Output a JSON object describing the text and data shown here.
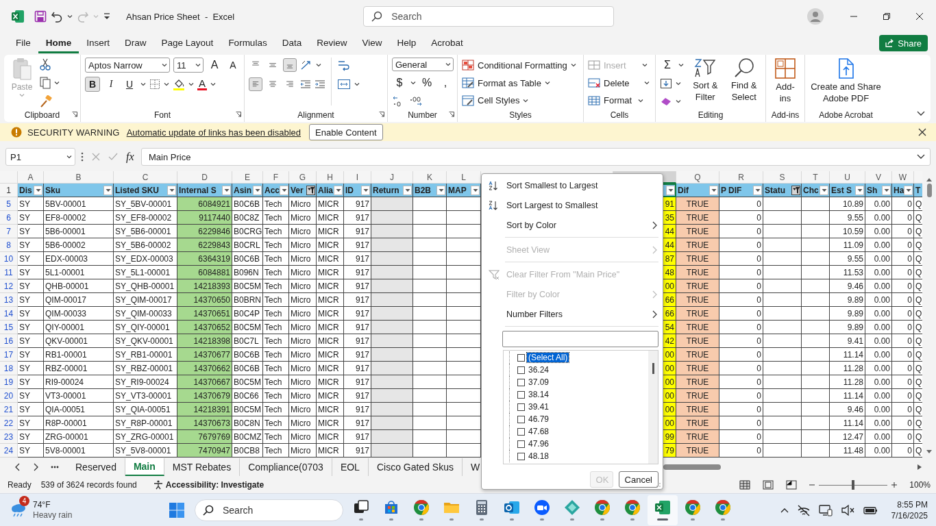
{
  "window": {
    "title": "Ahsan Price Sheet  -  Excel",
    "search_placeholder": "Search"
  },
  "ribbon_tabs": [
    {
      "label": "File",
      "selected": false
    },
    {
      "label": "Home",
      "selected": true
    },
    {
      "label": "Insert",
      "selected": false
    },
    {
      "label": "Draw",
      "selected": false
    },
    {
      "label": "Page Layout",
      "selected": false
    },
    {
      "label": "Formulas",
      "selected": false
    },
    {
      "label": "Data",
      "selected": false
    },
    {
      "label": "Review",
      "selected": false
    },
    {
      "label": "View",
      "selected": false
    },
    {
      "label": "Help",
      "selected": false
    },
    {
      "label": "Acrobat",
      "selected": false
    }
  ],
  "share_button": "Share",
  "ribbon": {
    "paste": "Paste",
    "font_name": "Aptos Narrow",
    "font_size": "11",
    "size_buttons": [
      "A",
      "A"
    ],
    "format_toggles": [
      {
        "kind": "bold",
        "label": "B",
        "on": true
      },
      {
        "kind": "italic",
        "label": "I",
        "on": false
      },
      {
        "kind": "underline",
        "label": "U",
        "on": false
      }
    ],
    "font_color_label": "A",
    "vertical_align": [
      {
        "kind": "top",
        "on": false
      },
      {
        "kind": "middle",
        "on": false
      },
      {
        "kind": "bottom",
        "on": true
      }
    ],
    "horizontal_align": [
      {
        "kind": "left",
        "on": true
      },
      {
        "kind": "center",
        "on": false
      },
      {
        "kind": "right",
        "on": false
      }
    ],
    "number_format": "General",
    "number_buttons": [
      "$",
      "%",
      ","
    ],
    "styles": [
      "Conditional Formatting",
      "Format as Table",
      "Cell Styles"
    ],
    "cells": [
      {
        "label": "Insert",
        "disabled": true
      },
      {
        "label": "Delete",
        "disabled": false
      },
      {
        "label": "Format",
        "disabled": false
      }
    ],
    "sum_label": "Σ",
    "editing": [
      "Sort & Filter",
      "Find & Select"
    ],
    "addins": "Add-ins",
    "acrobat": "Create and Share Adobe PDF",
    "group_labels": [
      "Clipboard",
      "Font",
      "Alignment",
      "Number",
      "Styles",
      "Cells",
      "Editing",
      "Add-ins",
      "Adobe Acrobat"
    ]
  },
  "security_bar": {
    "title": "SECURITY WARNING",
    "message": "Automatic update of links has been disabled",
    "button": "Enable Content"
  },
  "formula_bar": {
    "name_box": "P1",
    "function_label": "fx",
    "formula": "Main Price"
  },
  "columns": [
    {
      "letter": "A",
      "header": "Dis",
      "kind": "text",
      "filtered": false,
      "selected": false
    },
    {
      "letter": "B",
      "header": "Sku",
      "kind": "text",
      "filtered": false,
      "selected": false
    },
    {
      "letter": "C",
      "header": "Listed SKU",
      "kind": "text",
      "filtered": false,
      "selected": false
    },
    {
      "letter": "D",
      "header": "Internal S",
      "kind": "number",
      "color": "#a6d98f",
      "filtered": false,
      "selected": false
    },
    {
      "letter": "E",
      "header": "Asin",
      "kind": "text",
      "filtered": false,
      "selected": false
    },
    {
      "letter": "F",
      "header": "Acc",
      "kind": "text",
      "filtered": false,
      "selected": false
    },
    {
      "letter": "G",
      "header": "Ver",
      "kind": "text",
      "filtered": true,
      "selected": false
    },
    {
      "letter": "H",
      "header": "Alia",
      "kind": "text",
      "filtered": false,
      "selected": false
    },
    {
      "letter": "I",
      "header": "ID",
      "kind": "number",
      "filtered": false,
      "selected": false
    },
    {
      "letter": "J",
      "header": "Return",
      "kind": "text",
      "color": "#e6e6e6",
      "filtered": false,
      "selected": false
    },
    {
      "letter": "K",
      "header": "B2B",
      "kind": "text",
      "filtered": false,
      "selected": false
    },
    {
      "letter": "L",
      "header": "MAP",
      "kind": "text",
      "filtered": false,
      "selected": false
    },
    {
      "kind": "number",
      "color": "#ffff00",
      "filtered": false,
      "selected": true
    },
    {
      "letter": "Q",
      "header": "Dif",
      "kind": "bool",
      "color": "#f8cbad",
      "filtered": false,
      "selected": false
    },
    {
      "letter": "R",
      "header": "P DIF",
      "kind": "number",
      "filtered": false,
      "selected": false
    },
    {
      "letter": "S",
      "header": "Statu",
      "kind": "text",
      "filtered": true,
      "selected": false
    },
    {
      "letter": "T",
      "header": "Chc",
      "kind": "text",
      "filtered": false,
      "selected": false
    },
    {
      "letter": "U",
      "header": "Est S",
      "kind": "number",
      "filtered": false,
      "selected": false
    },
    {
      "letter": "V",
      "header": "Sh",
      "kind": "number",
      "filtered": false,
      "selected": false
    },
    {
      "letter": "W",
      "header": "Ha",
      "kind": "number",
      "filtered": false,
      "selected": false
    },
    {
      "header": "T",
      "kind": "text",
      "selected": false
    }
  ],
  "header_row": "1",
  "rows": [
    {
      "number": "5",
      "cells": [
        "SY",
        "5BV-00001",
        "SY_5BV-00001",
        "6084921",
        "B0C6B",
        "Tech",
        "Micro",
        "MICR",
        "917",
        null,
        null,
        null,
        "91",
        "TRUE",
        "0",
        null,
        null,
        "10.89",
        "0.00",
        "0",
        "Q"
      ]
    },
    {
      "number": "6",
      "cells": [
        "SY",
        "EF8-00002",
        "SY_EF8-00002",
        "9117440",
        "B0C8Z",
        "Tech",
        "Micro",
        "MICR",
        "917",
        null,
        null,
        null,
        "35",
        "TRUE",
        "0",
        null,
        null,
        "9.55",
        "0.00",
        "0",
        "Q"
      ]
    },
    {
      "number": "7",
      "cells": [
        "SY",
        "5B6-00001",
        "SY_5B6-00001",
        "6229846",
        "B0CRG",
        "Tech",
        "Micro",
        "MICR",
        "917",
        null,
        null,
        null,
        "44",
        "TRUE",
        "0",
        null,
        null,
        "10.59",
        "0.00",
        "0",
        "Q"
      ]
    },
    {
      "number": "8",
      "cells": [
        "SY",
        "5B6-00002",
        "SY_5B6-00002",
        "6229843",
        "B0CRL",
        "Tech",
        "Micro",
        "MICR",
        "917",
        null,
        null,
        null,
        "44",
        "TRUE",
        "0",
        null,
        null,
        "11.09",
        "0.00",
        "0",
        "Q"
      ]
    },
    {
      "number": "10",
      "cells": [
        "SY",
        "EDX-00003",
        "SY_EDX-00003",
        "6364319",
        "B0C6B",
        "Tech",
        "Micro",
        "MICR",
        "917",
        null,
        null,
        null,
        "87",
        "TRUE",
        "0",
        null,
        null,
        "9.55",
        "0.00",
        "0",
        "Q"
      ]
    },
    {
      "number": "11",
      "cells": [
        "SY",
        "5L1-00001",
        "SY_5L1-00001",
        "6084881",
        "B096N",
        "Tech",
        "Micro",
        "MICR",
        "917",
        null,
        null,
        null,
        "48",
        "TRUE",
        "0",
        null,
        null,
        "11.53",
        "0.00",
        "0",
        "Q"
      ]
    },
    {
      "number": "12",
      "cells": [
        "SY",
        "QHB-00001",
        "SY_QHB-00001",
        "14218393",
        "B0C5M",
        "Tech",
        "Micro",
        "MICR",
        "917",
        null,
        null,
        null,
        "00",
        "TRUE",
        "0",
        null,
        null,
        "9.46",
        "0.00",
        "0",
        "Q"
      ]
    },
    {
      "number": "13",
      "cells": [
        "SY",
        "QIM-00017",
        "SY_QIM-00017",
        "14370650",
        "B0BRN",
        "Tech",
        "Micro",
        "MICR",
        "917",
        null,
        null,
        null,
        "66",
        "TRUE",
        "0",
        null,
        null,
        "9.89",
        "0.00",
        "0",
        "Q"
      ]
    },
    {
      "number": "14",
      "cells": [
        "SY",
        "QIM-00033",
        "SY_QIM-00033",
        "14370651",
        "B0C4P",
        "Tech",
        "Micro",
        "MICR",
        "917",
        null,
        null,
        null,
        "66",
        "TRUE",
        "0",
        null,
        null,
        "9.89",
        "0.00",
        "0",
        "Q"
      ]
    },
    {
      "number": "15",
      "cells": [
        "SY",
        "QIY-00001",
        "SY_QIY-00001",
        "14370652",
        "B0C5M",
        "Tech",
        "Micro",
        "MICR",
        "917",
        null,
        null,
        null,
        "54",
        "TRUE",
        "0",
        null,
        null,
        "9.89",
        "0.00",
        "0",
        "Q"
      ]
    },
    {
      "number": "16",
      "cells": [
        "SY",
        "QKV-00001",
        "SY_QKV-00001",
        "14218398",
        "B0C7L",
        "Tech",
        "Micro",
        "MICR",
        "917",
        null,
        null,
        null,
        "42",
        "TRUE",
        "0",
        null,
        null,
        "9.41",
        "0.00",
        "0",
        "Q"
      ]
    },
    {
      "number": "17",
      "cells": [
        "SY",
        "RB1-00001",
        "SY_RB1-00001",
        "14370677",
        "B0C6B",
        "Tech",
        "Micro",
        "MICR",
        "917",
        null,
        null,
        null,
        "00",
        "TRUE",
        "0",
        null,
        null,
        "11.14",
        "0.00",
        "0",
        "Q"
      ]
    },
    {
      "number": "18",
      "cells": [
        "SY",
        "RBZ-00001",
        "SY_RBZ-00001",
        "14370662",
        "B0C6B",
        "Tech",
        "Micro",
        "MICR",
        "917",
        null,
        null,
        null,
        "00",
        "TRUE",
        "0",
        null,
        null,
        "11.28",
        "0.00",
        "0",
        "Q"
      ]
    },
    {
      "number": "19",
      "cells": [
        "SY",
        "RI9-00024",
        "SY_RI9-00024",
        "14370667",
        "B0C5M",
        "Tech",
        "Micro",
        "MICR",
        "917",
        null,
        null,
        null,
        "00",
        "TRUE",
        "0",
        null,
        null,
        "11.28",
        "0.00",
        "0",
        "Q"
      ]
    },
    {
      "number": "20",
      "cells": [
        "SY",
        "VT3-00001",
        "SY_VT3-00001",
        "14370679",
        "B0C66",
        "Tech",
        "Micro",
        "MICR",
        "917",
        null,
        null,
        null,
        "00",
        "TRUE",
        "0",
        null,
        null,
        "11.14",
        "0.00",
        "0",
        "Q"
      ]
    },
    {
      "number": "21",
      "cells": [
        "SY",
        "QIA-00051",
        "SY_QIA-00051",
        "14218391",
        "B0C5M",
        "Tech",
        "Micro",
        "MICR",
        "917",
        null,
        null,
        null,
        "00",
        "TRUE",
        "0",
        null,
        null,
        "9.46",
        "0.00",
        "0",
        "Q"
      ]
    },
    {
      "number": "22",
      "cells": [
        "SY",
        "R8P-00001",
        "SY_R8P-00001",
        "14370673",
        "B0C8N",
        "Tech",
        "Micro",
        "MICR",
        "917",
        null,
        null,
        null,
        "00",
        "TRUE",
        "0",
        null,
        null,
        "11.14",
        "0.00",
        "0",
        "Q"
      ]
    },
    {
      "number": "23",
      "cells": [
        "SY",
        "ZRG-00001",
        "SY_ZRG-00001",
        "7679769",
        "B0CMZ",
        "Tech",
        "Micro",
        "MICR",
        "917",
        null,
        null,
        null,
        "99",
        "TRUE",
        "0",
        null,
        null,
        "12.47",
        "0.00",
        "0",
        "Q"
      ]
    },
    {
      "number": "24",
      "cells": [
        "SY",
        "5V8-00001",
        "SY_5V8-00001",
        "7470947",
        "B0CB8",
        "Tech",
        "Micro",
        "MICR",
        "917",
        null,
        null,
        null,
        "79",
        "TRUE",
        "0",
        null,
        null,
        "11.48",
        "0.00",
        "0",
        "Q"
      ]
    }
  ],
  "filter_menu": {
    "sections": [
      [
        {
          "label": "Sort Smallest to Largest",
          "kind": "sort-asc",
          "submenu": false,
          "disabled": false
        },
        {
          "label": "Sort Largest to Smallest",
          "kind": "sort-desc",
          "submenu": false,
          "disabled": false
        },
        {
          "label": "Sort by Color",
          "kind": "plain",
          "submenu": true,
          "disabled": false
        }
      ],
      [
        {
          "label": "Sheet View",
          "kind": "plain",
          "submenu": true,
          "disabled": true
        }
      ],
      [
        {
          "label": "Clear Filter From \"Main Price\"",
          "kind": "clear-filter",
          "submenu": false,
          "disabled": true
        },
        {
          "label": "Filter by Color",
          "kind": "plain",
          "submenu": true,
          "disabled": true
        },
        {
          "label": "Number Filters",
          "kind": "plain",
          "submenu": true,
          "disabled": false
        }
      ]
    ],
    "values": [
      {
        "label": "(Select All)",
        "checked": false,
        "selected": true
      },
      {
        "label": "36.24",
        "checked": false,
        "selected": false
      },
      {
        "label": "37.09",
        "checked": false,
        "selected": false
      },
      {
        "label": "38.14",
        "checked": false,
        "selected": false
      },
      {
        "label": "39.41",
        "checked": false,
        "selected": false
      },
      {
        "label": "46.79",
        "checked": false,
        "selected": false
      },
      {
        "label": "47.68",
        "checked": false,
        "selected": false
      },
      {
        "label": "47.96",
        "checked": false,
        "selected": false
      },
      {
        "label": "48.18",
        "checked": false,
        "selected": false
      }
    ],
    "buttons": [
      {
        "label": "OK",
        "disabled": true
      },
      {
        "label": "Cancel",
        "disabled": false
      }
    ]
  },
  "sheet_tabs": [
    {
      "label": "Reserved",
      "selected": false
    },
    {
      "label": "Main",
      "selected": true
    },
    {
      "label": "MST Rebates",
      "selected": false
    },
    {
      "label": "Compliance(0703",
      "selected": false
    },
    {
      "label": "EOL",
      "selected": false
    },
    {
      "label": "Cisco Gated Skus",
      "selected": false
    },
    {
      "label": "W",
      "selected": false
    }
  ],
  "status_bar": {
    "mode": "Ready",
    "records": "539 of 3624 records found",
    "accessibility": "Accessibility: Investigate",
    "zoom": {
      "level": 0.5
    },
    "zoom_label": "100%"
  },
  "taskbar": {
    "weather": {
      "badge": "4",
      "temperature": "74°F",
      "condition": "Heavy rain"
    },
    "search_placeholder": "Search",
    "apps": [
      {
        "kind": "task-view",
        "active": false
      },
      {
        "kind": "store",
        "active": false
      },
      {
        "kind": "browser",
        "active": false
      },
      {
        "kind": "folder",
        "active": false
      },
      {
        "kind": "calculator",
        "active": false
      },
      {
        "kind": "mail",
        "active": false
      },
      {
        "kind": "video",
        "active": false
      },
      {
        "kind": "diamond",
        "active": false
      },
      {
        "kind": "browser",
        "active": false
      },
      {
        "kind": "browser",
        "active": false
      },
      {
        "kind": "spreadsheet",
        "active": true
      },
      {
        "kind": "browser",
        "active": false
      },
      {
        "kind": "browser",
        "active": false
      }
    ],
    "time": "8:55 PM",
    "date": "7/16/2025"
  }
}
